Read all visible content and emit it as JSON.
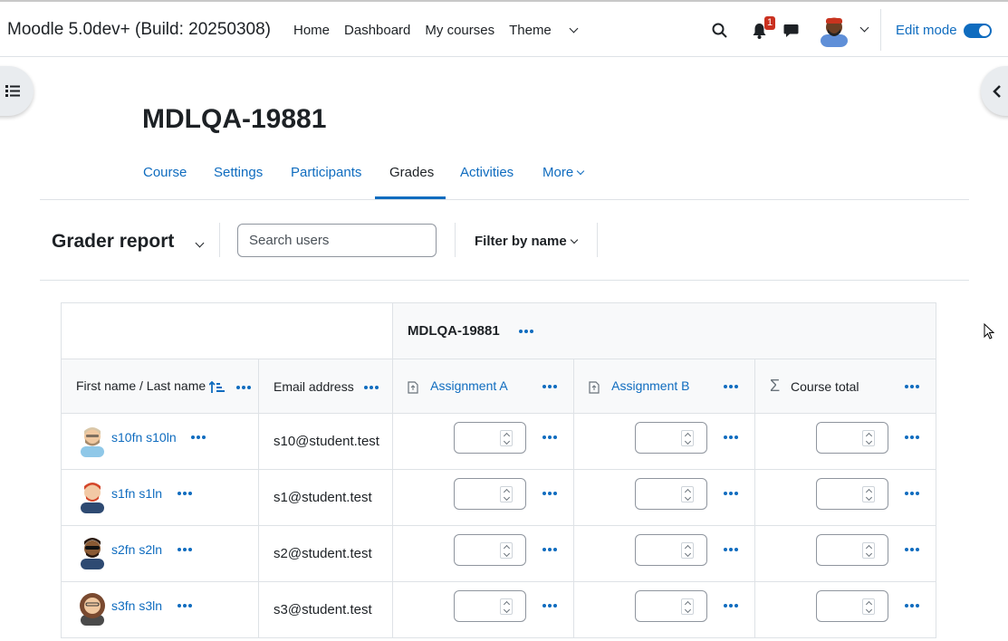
{
  "header": {
    "site_name": "Moodle 5.0dev+ (Build: 20250308)",
    "nav": [
      "Home",
      "Dashboard",
      "My courses",
      "Theme"
    ],
    "notification_count": "1",
    "edit_mode_label": "Edit mode"
  },
  "page": {
    "title": "MDLQA-19881"
  },
  "course_nav": {
    "tabs": [
      "Course",
      "Settings",
      "Participants",
      "Grades",
      "Activities",
      "More"
    ],
    "active": "Grades"
  },
  "tertiary": {
    "report_title": "Grader report",
    "search_placeholder": "Search users",
    "filter_label": "Filter by name"
  },
  "grader": {
    "category": "MDLQA-19881",
    "columns": {
      "name": "First name / Last name",
      "email": "Email address",
      "items": [
        "Assignment A",
        "Assignment B",
        "Course total"
      ]
    },
    "rows": [
      {
        "name": "s10fn s10ln",
        "email": "s10@student.test"
      },
      {
        "name": "s1fn s1ln",
        "email": "s1@student.test"
      },
      {
        "name": "s2fn s2ln",
        "email": "s2@student.test"
      },
      {
        "name": "s3fn s3ln",
        "email": "s3@student.test"
      }
    ]
  },
  "colors": {
    "primary": "#0f6cbf",
    "badge": "#ca3120"
  }
}
